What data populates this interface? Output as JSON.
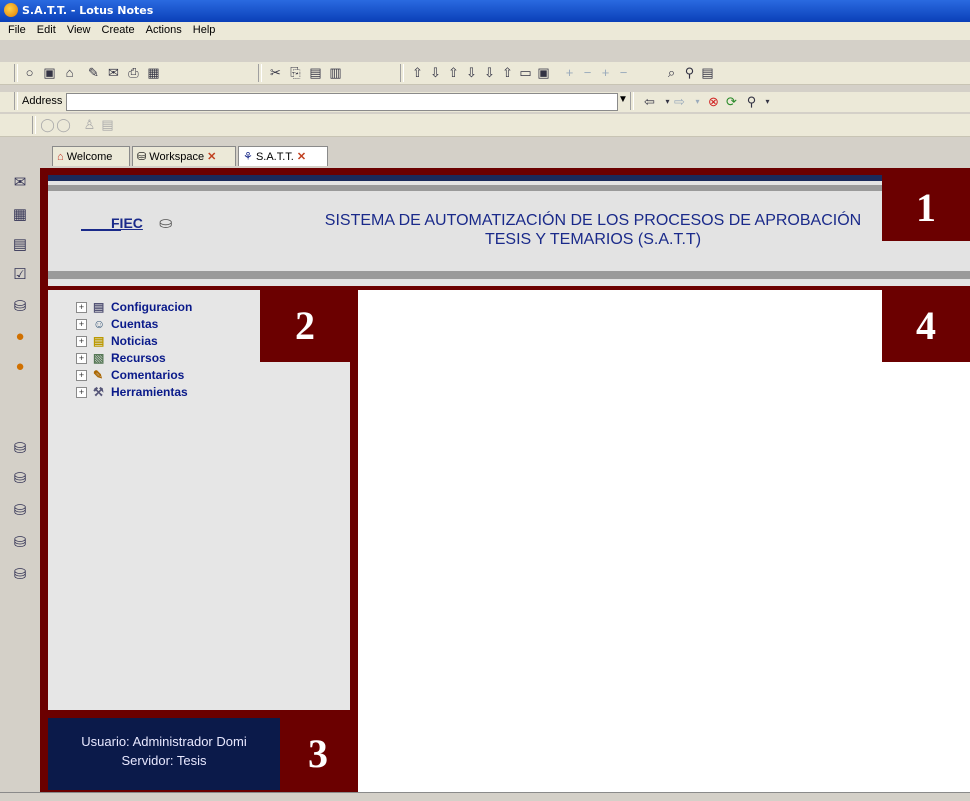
{
  "window": {
    "title": "S.A.T.T. - Lotus Notes"
  },
  "menu": [
    "File",
    "Edit",
    "View",
    "Create",
    "Actions",
    "Help"
  ],
  "address": {
    "label": "Address",
    "value": ""
  },
  "tabs": [
    {
      "label": "Welcome",
      "icon": "home-icon"
    },
    {
      "label": "Workspace",
      "icon": "workspace-icon"
    },
    {
      "label": "S.A.T.T.",
      "icon": "satt-icon"
    }
  ],
  "header": {
    "logo_text": "FIEC",
    "title": "SISTEMA DE AUTOMATIZACIÓN DE LOS PROCESOS DE APROBACIÓN\nTESIS Y TEMARIOS (S.A.T.T)"
  },
  "nav": {
    "items": [
      {
        "label": "Configuracion",
        "icon": "settings-icon"
      },
      {
        "label": "Cuentas",
        "icon": "users-icon"
      },
      {
        "label": "Noticias",
        "icon": "news-icon"
      },
      {
        "label": "Recursos",
        "icon": "resources-icon"
      },
      {
        "label": "Comentarios",
        "icon": "comments-icon"
      },
      {
        "label": "Herramientas",
        "icon": "tools-icon"
      }
    ]
  },
  "user": {
    "line1": "Usuario: Administrador Domi",
    "line2": "Servidor: Tesis"
  },
  "markers": [
    "1",
    "2",
    "3",
    "4"
  ]
}
